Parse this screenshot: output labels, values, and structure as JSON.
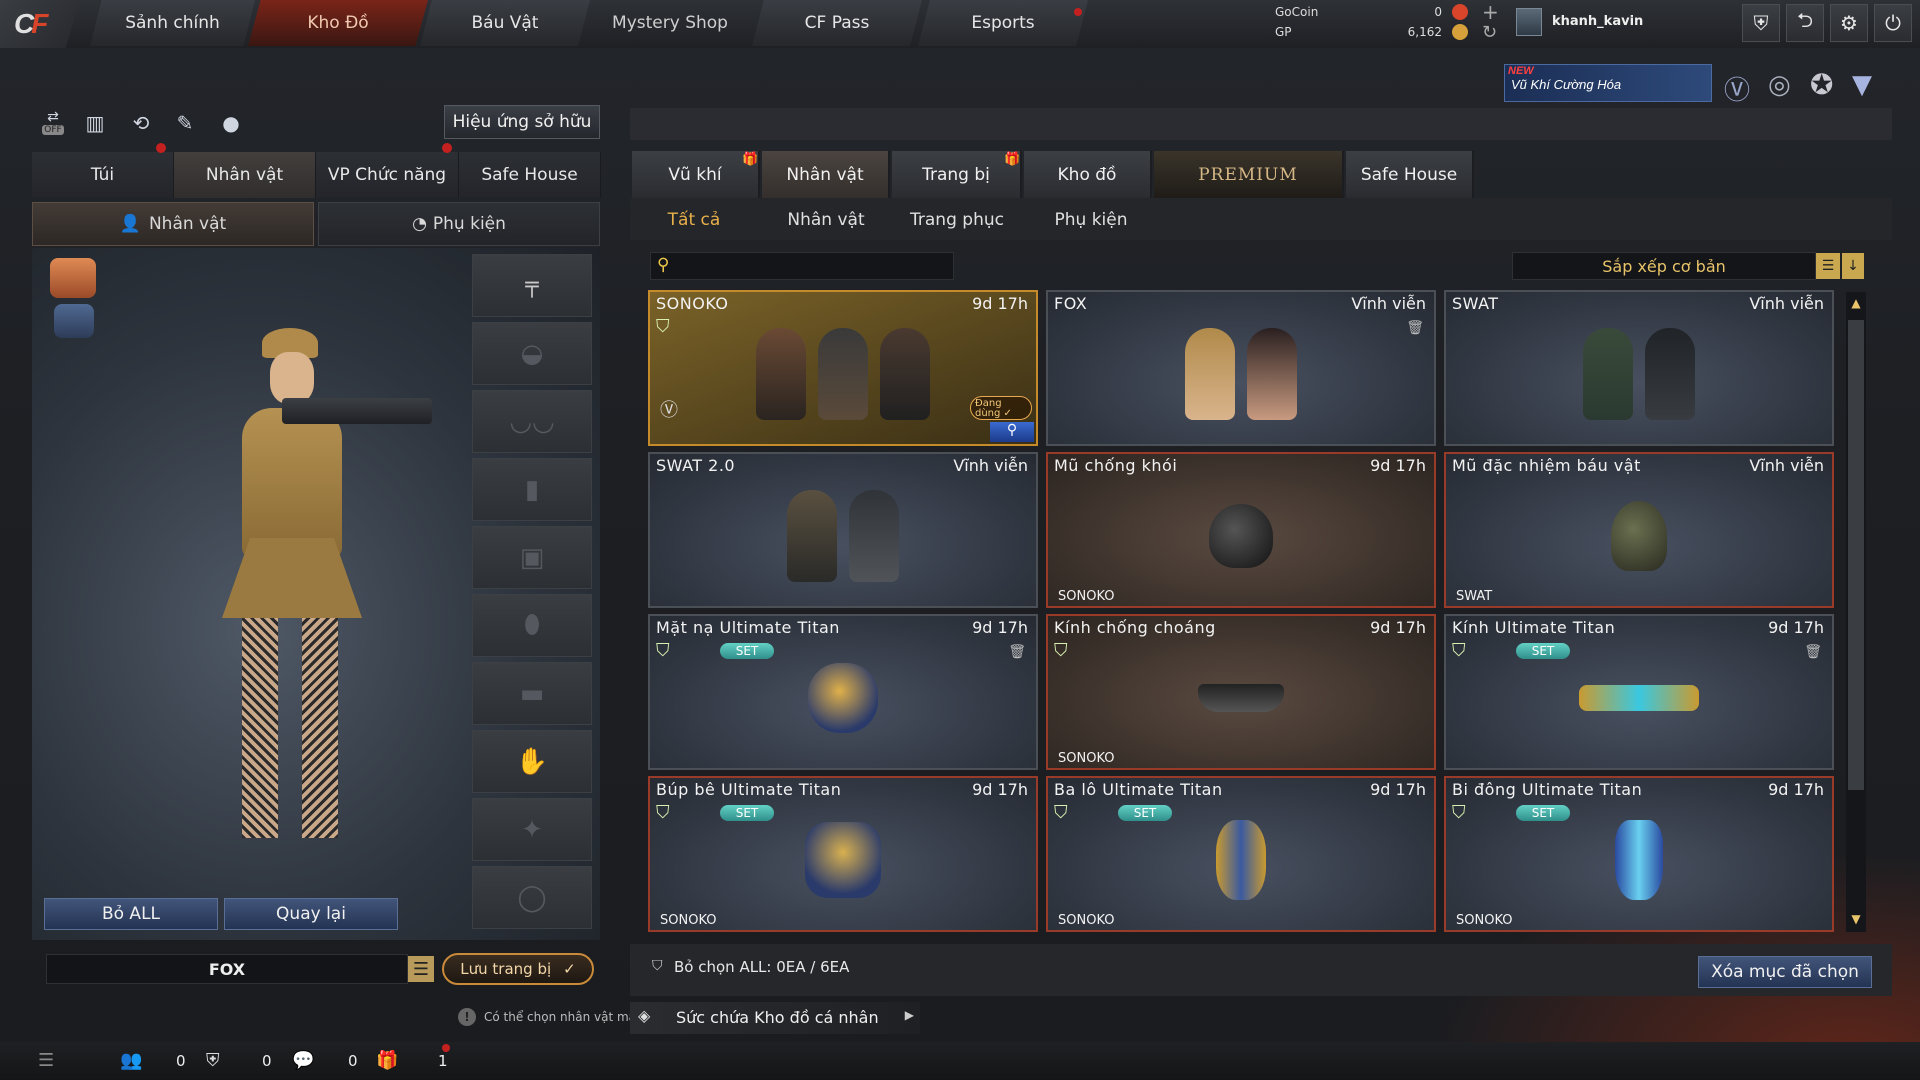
{
  "nav": {
    "tabs": [
      "Sảnh chính",
      "Kho Đồ",
      "Báu Vật",
      "Mystery Shop",
      "CF Pass",
      "Esports"
    ]
  },
  "currency": {
    "gocoin_label": "GoCoin",
    "gp_label": "GP",
    "gocoin_value": "0",
    "gp_value": "6,162"
  },
  "user": {
    "name": "khanh_kavin"
  },
  "promo": {
    "new": "NEW",
    "text": "Vũ Khí Cường Hóa"
  },
  "left": {
    "off_label": "OFF",
    "effects_button": "Hiệu ứng sở hữu",
    "tabs": [
      "Túi",
      "Nhân vật",
      "VP Chức năng",
      "Safe House"
    ],
    "subtabs": [
      "Nhân vật",
      "Phụ kiện"
    ],
    "remove_all": "Bỏ ALL",
    "back": "Quay lại",
    "character_name": "FOX",
    "save_loadout": "Lưu trang bị",
    "hint": "Có thể chọn nhân vật mà"
  },
  "right": {
    "tabs": [
      "Vũ khí",
      "Nhân vật",
      "Trang bị",
      "Kho đồ",
      "PREMIUM",
      "Safe House"
    ],
    "subtabs": [
      "Tất cả",
      "Nhân vật",
      "Trang phục",
      "Phụ kiện"
    ],
    "search_placeholder": "",
    "sort_label": "Sắp xếp cơ bản",
    "in_use": "Đang dùng",
    "cards": [
      {
        "name": "SONOKO",
        "time": "9d 17h",
        "owner": ""
      },
      {
        "name": "FOX",
        "time": "Vĩnh viễn",
        "owner": ""
      },
      {
        "name": "SWAT",
        "time": "Vĩnh viễn",
        "owner": ""
      },
      {
        "name": "SWAT 2.0",
        "time": "Vĩnh viễn",
        "owner": ""
      },
      {
        "name": "Mũ chống khói",
        "time": "9d 17h",
        "owner": "SONOKO"
      },
      {
        "name": "Mũ đặc nhiệm báu vật",
        "time": "Vĩnh viễn",
        "owner": "SWAT"
      },
      {
        "name": "Mặt nạ Ultimate Titan",
        "time": "9d 17h",
        "owner": "",
        "set": "SET"
      },
      {
        "name": "Kính chống choáng",
        "time": "9d 17h",
        "owner": "SONOKO"
      },
      {
        "name": "Kính Ultimate Titan",
        "time": "9d 17h",
        "owner": "",
        "set": "SET"
      },
      {
        "name": "Búp bê Ultimate Titan",
        "time": "9d 17h",
        "owner": "SONOKO",
        "set": "SET"
      },
      {
        "name": "Ba lô Ultimate Titan",
        "time": "9d 17h",
        "owner": "SONOKO",
        "set": "SET"
      },
      {
        "name": "Bi đông Ultimate Titan",
        "time": "9d 17h",
        "owner": "SONOKO",
        "set": "SET"
      }
    ],
    "deselect": "Bỏ chọn ALL: 0EA / 6EA",
    "delete_selected": "Xóa mục đã chọn",
    "capacity": "Sức chứa Kho đồ cá nhân"
  },
  "statusbar": {
    "c1": "0",
    "c2": "0",
    "c3": "0",
    "c4": "1"
  }
}
